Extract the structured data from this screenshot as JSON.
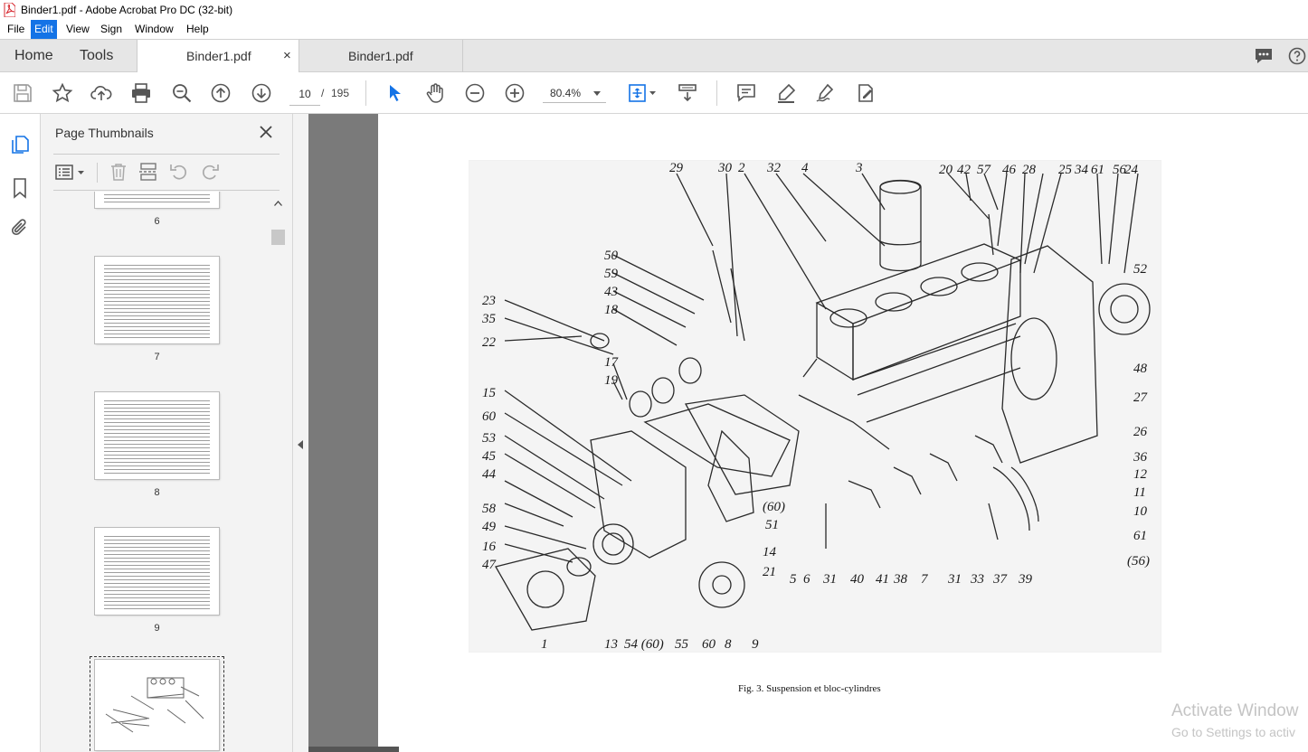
{
  "window": {
    "title": "Binder1.pdf - Adobe Acrobat Pro DC (32-bit)"
  },
  "menubar": {
    "items": [
      "File",
      "Edit",
      "View",
      "Sign",
      "Window",
      "Help"
    ],
    "active": "Edit"
  },
  "tabs": {
    "home": "Home",
    "tools": "Tools",
    "documents": [
      "Binder1.pdf",
      "Binder1.pdf"
    ],
    "close_glyph": "×"
  },
  "toolbar": {
    "current_page": "10",
    "page_separator": "/",
    "page_count": "195",
    "zoom": "80.4%"
  },
  "thumbnails": {
    "title": "Page Thumbnails",
    "pages": [
      "6",
      "7",
      "8",
      "9"
    ]
  },
  "figure": {
    "caption": "Fig. 3. Suspension et bloc-cylindres",
    "callouts": [
      "29",
      "30",
      "2",
      "32",
      "4",
      "3",
      "20",
      "42",
      "57",
      "46",
      "28",
      "25",
      "34",
      "61",
      "56",
      "24",
      "50",
      "59",
      "43",
      "18",
      "23",
      "35",
      "22",
      "17",
      "19",
      "52",
      "48",
      "27",
      "26",
      "36",
      "12",
      "11",
      "10",
      "61",
      "(56)",
      "15",
      "60",
      "53",
      "45",
      "44",
      "58",
      "49",
      "16",
      "47",
      "(60)",
      "51",
      "14",
      "21",
      "5",
      "6",
      "31",
      "40",
      "41",
      "38",
      "7",
      "31",
      "33",
      "37",
      "39",
      "1",
      "13",
      "54 (60)",
      "55",
      "60",
      "8",
      "9"
    ]
  },
  "watermark": {
    "line1": "Activate Window",
    "line2": "Go to Settings to activ"
  },
  "colors": {
    "accent": "#1473e6",
    "acrobat_red": "#d7282f",
    "doc_background": "#7a7a7a"
  }
}
